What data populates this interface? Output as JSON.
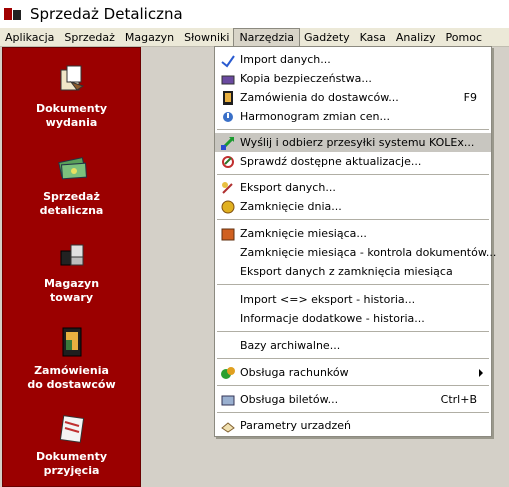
{
  "window": {
    "title": "Sprzedaż Detaliczna"
  },
  "menubar": [
    "Aplikacja",
    "Sprzedaż",
    "Magazyn",
    "Słowniki",
    "Narzędzia",
    "Gadżety",
    "Kasa",
    "Analizy",
    "Pomoc"
  ],
  "sidebar": [
    {
      "line1": "Dokumenty",
      "line2": "wydania"
    },
    {
      "line1": "Sprzedaż",
      "line2": "detaliczna"
    },
    {
      "line1": "Magazyn",
      "line2": "towary"
    },
    {
      "line1": "Zamówienia",
      "line2": "do dostawców"
    },
    {
      "line1": "Dokumenty",
      "line2": "przyjęcia"
    }
  ],
  "dropdown": {
    "items": [
      {
        "label": "Import danych...",
        "shortcut": ""
      },
      {
        "label": "Kopia bezpieczeństwa...",
        "shortcut": ""
      },
      {
        "label": "Zamówienia do dostawców...",
        "shortcut": "F9"
      },
      {
        "label": "Harmonogram zmian cen...",
        "shortcut": ""
      },
      {
        "label": "Wyślij i odbierz przesyłki systemu KOLEx...",
        "shortcut": ""
      },
      {
        "label": "Sprawdź dostępne aktualizacje...",
        "shortcut": ""
      },
      {
        "label": "Eksport danych...",
        "shortcut": ""
      },
      {
        "label": "Zamknięcie dnia...",
        "shortcut": ""
      },
      {
        "label": "Zamknięcie miesiąca...",
        "shortcut": ""
      },
      {
        "label": "Zamknięcie miesiąca - kontrola dokumentów...",
        "shortcut": ""
      },
      {
        "label": "Eksport danych z zamknięcia miesiąca",
        "shortcut": ""
      },
      {
        "label": "Import <=> eksport - historia...",
        "shortcut": ""
      },
      {
        "label": "Informacje dodatkowe - historia...",
        "shortcut": ""
      },
      {
        "label": "Bazy archiwalne...",
        "shortcut": ""
      },
      {
        "label": "Obsługa rachunków",
        "shortcut": ""
      },
      {
        "label": "Obsługa biletów...",
        "shortcut": "Ctrl+B"
      },
      {
        "label": "Parametry urzadzeń",
        "shortcut": ""
      }
    ]
  }
}
